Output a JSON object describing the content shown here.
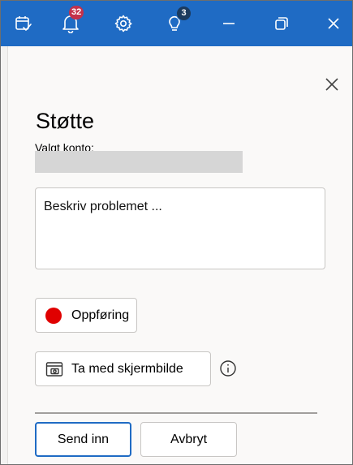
{
  "window": {
    "accent": "#1f6bc4",
    "toolbar": {
      "notifications_count": "32",
      "tips_count": "3",
      "icons": [
        "task-check-icon",
        "bell-icon",
        "gear-icon",
        "lightbulb-icon",
        "minimize-icon",
        "restore-icon",
        "close-icon"
      ]
    }
  },
  "panel": {
    "title": "Støtte",
    "account_label": "Valgt konto:",
    "description_placeholder": "Beskriv problemet ...",
    "record_label": "Oppføring",
    "record_color": "#e00000",
    "screenshot_label": "Ta med skjermbilde",
    "send_label": "Send inn",
    "cancel_label": "Avbryt"
  }
}
